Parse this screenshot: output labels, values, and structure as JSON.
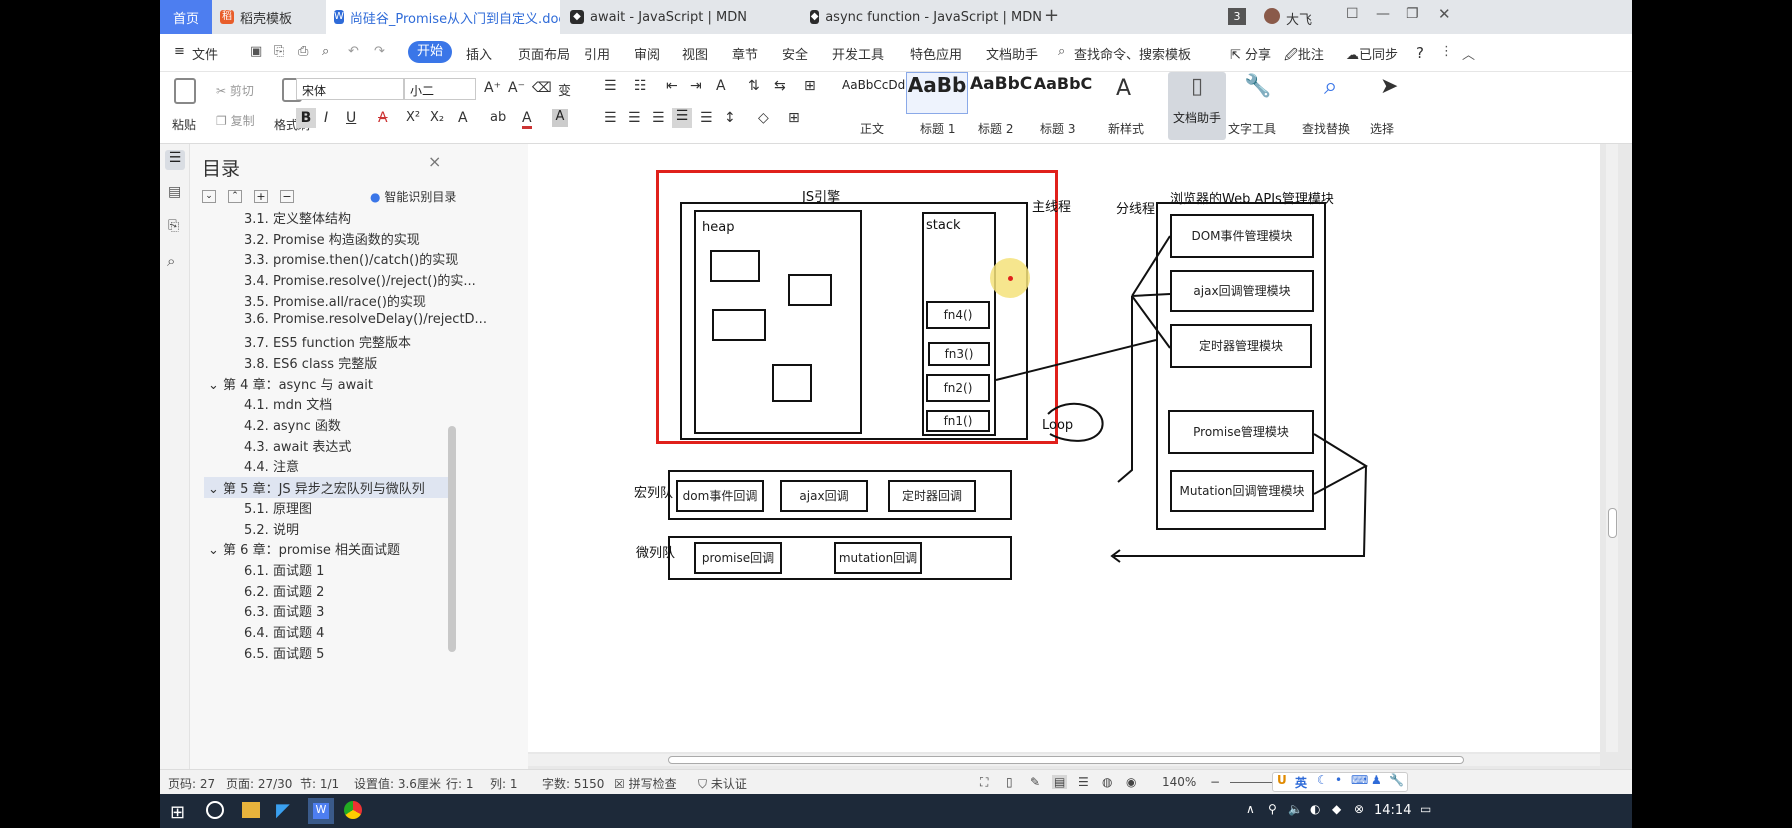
{
  "tabs": {
    "home": "首页",
    "daoke": "稻壳模板",
    "doc": "尚硅谷_Promise从入门到自定义.doc",
    "mdn_await": "await - JavaScript | MDN",
    "mdn_async": "async function - JavaScript | MDN",
    "add": "+",
    "badge": "3",
    "user": "大飞"
  },
  "menu": {
    "file": "文件",
    "start": "开始",
    "insert": "插入",
    "layout": "页面布局",
    "ref": "引用",
    "review": "审阅",
    "view": "视图",
    "chapter": "章节",
    "security": "安全",
    "devtools": "开发工具",
    "features": "特色应用",
    "assistant": "文档助手",
    "search": "查找命令、搜索模板",
    "share": "分享",
    "comment": "批注",
    "sync": "已同步",
    "help": "?"
  },
  "ribbon": {
    "paste": "粘贴",
    "cut": "剪切",
    "copy": "复制",
    "format_painter": "格式刷",
    "font_name": "宋体",
    "font_size": "小二",
    "styles": [
      {
        "preview": "AaBbCcDd",
        "name": "正文"
      },
      {
        "preview": "AaBb",
        "name": "标题 1"
      },
      {
        "preview": "AaBbC",
        "name": "标题 2"
      },
      {
        "preview": "AaBbC",
        "name": "标题 3"
      }
    ],
    "new_style": "新样式",
    "doc_helper": "文档助手",
    "text_tool": "文字工具",
    "find_replace": "查找替换",
    "select": "选择"
  },
  "toc": {
    "title": "目录",
    "smart": "智能识别目录",
    "items": [
      "3.1. 定义整体结构",
      "3.2. Promise 构造函数的实现",
      "3.3. promise.then()/catch()的实现",
      "3.4. Promise.resolve()/reject()的实...",
      "3.5. Promise.all/race()的实现",
      "3.6. Promise.resolveDelay()/rejectD...",
      "3.7. ES5 function 完整版本",
      "3.8. ES6 class 完整版",
      "第 4 章：async 与 await",
      "4.1. mdn 文档",
      "4.2. async 函数",
      "4.3. await 表达式",
      "4.4. 注意",
      "第 5 章：JS 异步之宏队列与微队列",
      "5.1. 原理图",
      "5.2. 说明",
      "第 6 章：promise 相关面试题",
      "6.1. 面试题 1",
      "6.2. 面试题 2",
      "6.3. 面试题 3",
      "6.4. 面试题 4",
      "6.5. 面试题 5"
    ]
  },
  "diagram": {
    "js_engine": "JS引擎",
    "heap": "heap",
    "stack": "stack",
    "main_thread": "主线程",
    "sub_thread": "分线程",
    "webapis": "浏览器的Web APIs管理模块",
    "dom_mgr": "DOM事件管理模块",
    "ajax_mgr": "ajax回调管理模块",
    "timer_mgr": "定时器管理模块",
    "promise_mgr": "Promise管理模块",
    "mutation_mgr": "Mutation回调管理模块",
    "fn4": "fn4()",
    "fn3": "fn3()",
    "fn2": "fn2()",
    "fn1": "fn1()",
    "loop": "Loop",
    "macro": "宏列队",
    "micro": "微列队",
    "dom_cb": "dom事件回调",
    "ajax_cb": "ajax回调",
    "timer_cb": "定时器回调",
    "promise_cb": "promise回调",
    "mutation_cb": "mutation回调"
  },
  "status": {
    "page_no": "页码: 27",
    "pages": "页面: 27/30",
    "section": "节: 1/1",
    "setting": "设置值: 3.6厘米",
    "row": "行: 1",
    "col": "列: 1",
    "words": "字数: 5150",
    "spell": "拼写检查",
    "cert": "未认证",
    "zoom": "140%",
    "ime": "英"
  },
  "taskbar": {
    "time": "14:14"
  },
  "colors": {
    "accent": "#4d7ef0",
    "red_frame": "#e0201b",
    "highlight": "#f5e27a"
  }
}
